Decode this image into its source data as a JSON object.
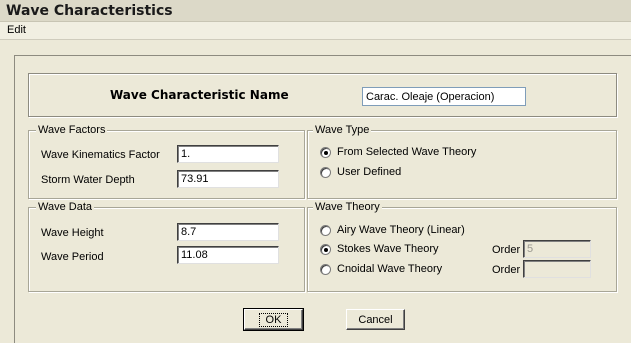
{
  "window": {
    "title": "Wave Characteristics"
  },
  "menu": {
    "edit": "Edit"
  },
  "name_section": {
    "label": "Wave Characteristic Name",
    "value": "Carac. Oleaje (Operacion)"
  },
  "wave_factors": {
    "title": "Wave Factors",
    "kinematics_label": "Wave Kinematics Factor",
    "kinematics_value": "1.",
    "storm_label": "Storm Water Depth",
    "storm_value": "73.91"
  },
  "wave_data": {
    "title": "Wave Data",
    "height_label": "Wave Height",
    "height_value": "8.7",
    "period_label": "Wave Period",
    "period_value": "11.08"
  },
  "wave_type": {
    "title": "Wave Type",
    "options": [
      {
        "label": "From Selected Wave Theory",
        "checked": true
      },
      {
        "label": "User Defined",
        "checked": false
      }
    ]
  },
  "wave_theory": {
    "title": "Wave Theory",
    "options": [
      {
        "label": "Airy Wave Theory (Linear)",
        "checked": false
      },
      {
        "label": "Stokes Wave Theory",
        "checked": true
      },
      {
        "label": "Cnoidal Wave Theory",
        "checked": false
      }
    ],
    "order_label": "Order",
    "stokes_order_value": "5",
    "cnoidal_order_value": ""
  },
  "buttons": {
    "ok": "OK",
    "cancel": "Cancel"
  }
}
